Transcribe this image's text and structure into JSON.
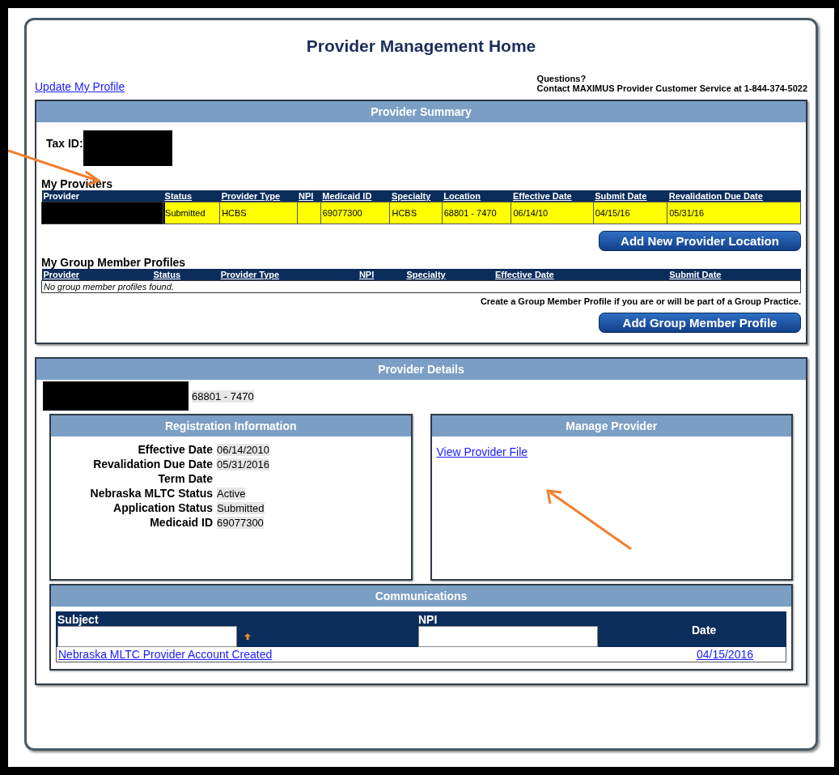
{
  "title": "Provider Management Home",
  "update_profile_link": "Update My Profile",
  "questions": {
    "heading": "Questions?",
    "contact": "Contact MAXIMUS Provider Customer Service at 1-844-374-5022"
  },
  "provider_summary": {
    "title": "Provider Summary",
    "tax_id_label": "Tax ID:",
    "my_providers": {
      "title": "My Providers",
      "columns": [
        "Provider",
        "Status",
        "Provider Type",
        "NPI",
        "Medicaid ID",
        "Specialty",
        "Location",
        "Effective Date",
        "Submit Date",
        "Revalidation Due Date"
      ],
      "rows": [
        {
          "highlighted": true,
          "cells": [
            "",
            "Submitted",
            "HCBS",
            "",
            "69077300",
            "HCBS",
            "68801 - 7470",
            "06/14/10",
            "04/15/16",
            "05/31/16"
          ]
        }
      ]
    },
    "add_location_button": "Add New Provider Location",
    "group_profiles": {
      "title": "My Group Member Profiles",
      "columns": [
        "Provider",
        "Status",
        "Provider Type",
        "NPI",
        "Specialty",
        "Effective Date",
        "Submit Date"
      ],
      "empty_message": "No group member profiles found.",
      "hint": "Create a Group Member Profile if you are or will be part of a Group Practice.",
      "add_button": "Add Group Member Profile"
    }
  },
  "provider_details": {
    "title": "Provider Details",
    "location": "68801 - 7470",
    "registration": {
      "title": "Registration Information",
      "fields": [
        {
          "label": "Effective Date",
          "value": "06/14/2010"
        },
        {
          "label": "Revalidation Due Date",
          "value": "05/31/2016"
        },
        {
          "label": "Term Date"
        },
        {
          "label": "Nebraska MLTC Status",
          "value": "Active"
        },
        {
          "label": "Application Status",
          "value": "Submitted"
        },
        {
          "label": "Medicaid ID",
          "value": "69077300"
        }
      ]
    },
    "manage": {
      "title": "Manage Provider",
      "link": "View Provider File"
    },
    "communications": {
      "title": "Communications",
      "columns": [
        "Subject",
        "NPI",
        "Date"
      ],
      "rows": [
        {
          "subject": "Nebraska MLTC Provider Account Created",
          "date": "04/15/2016"
        }
      ]
    }
  }
}
